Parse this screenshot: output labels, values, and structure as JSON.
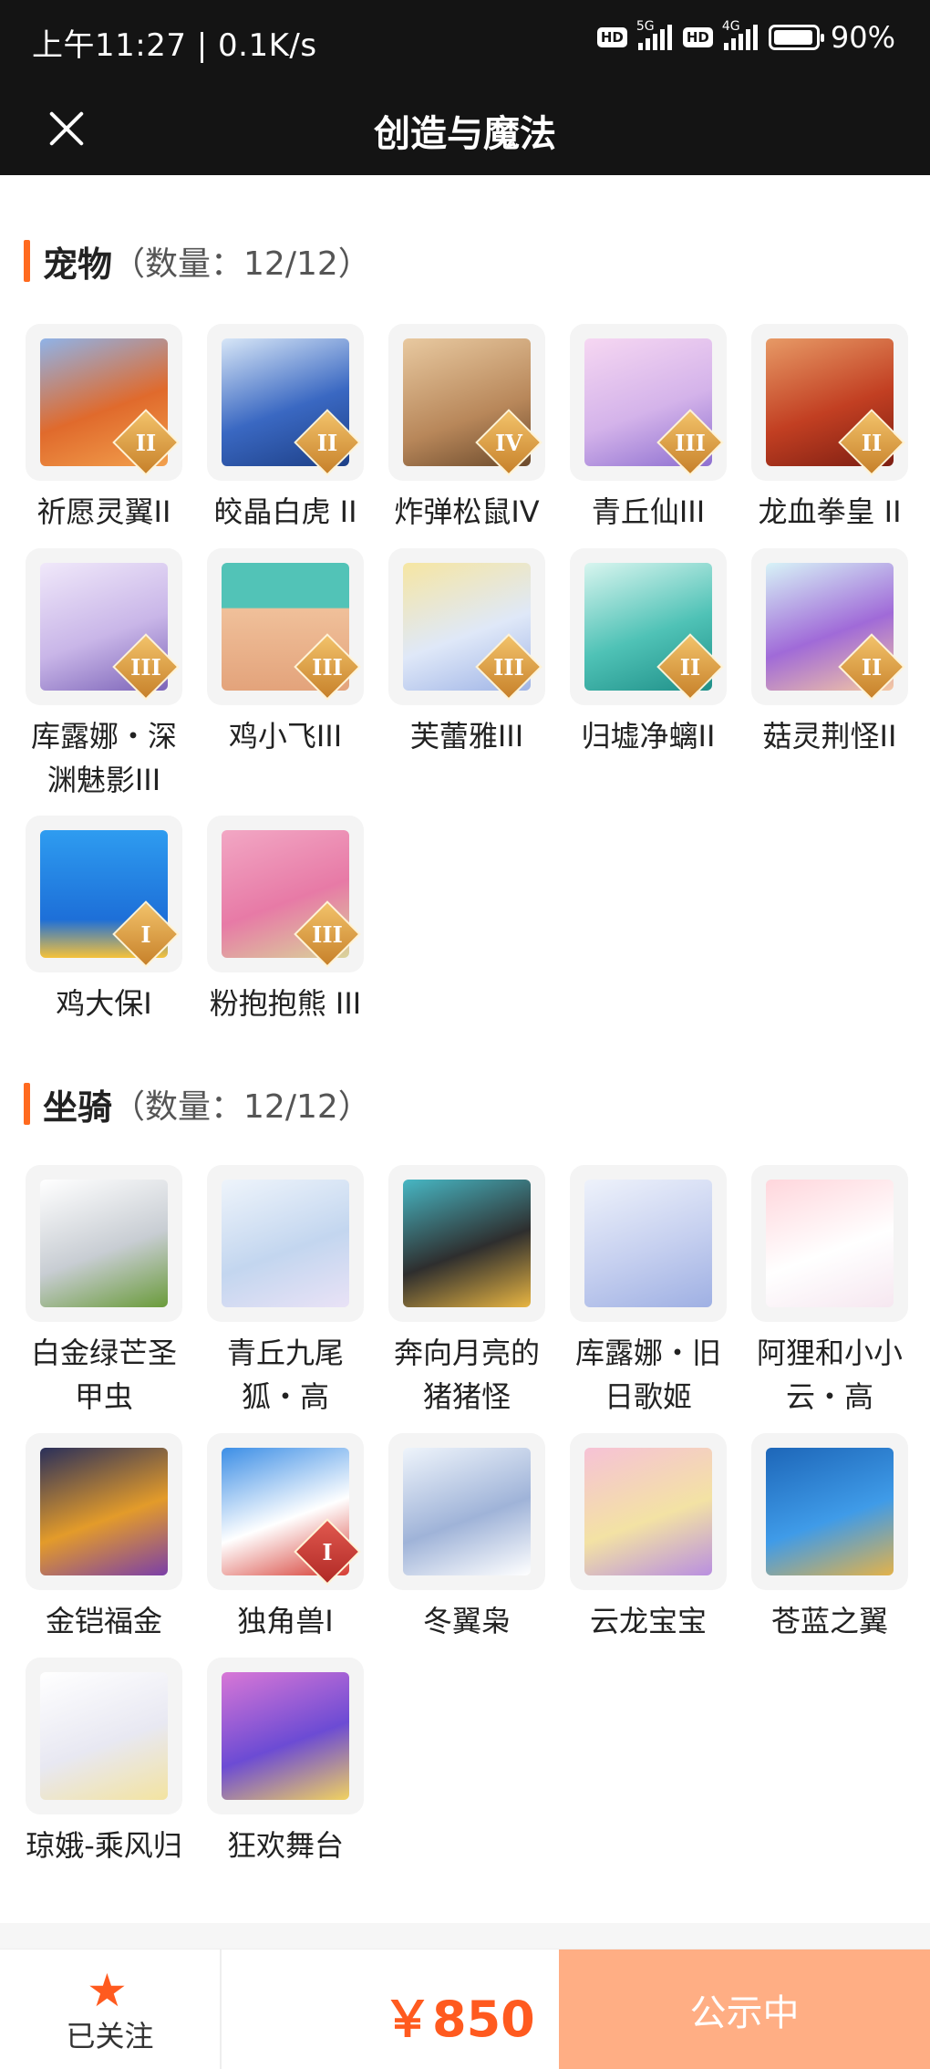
{
  "status_bar": {
    "time_speed": "上午11:27 | 0.1K/s",
    "hd1": "HD",
    "net1": "5G",
    "hd2": "HD",
    "net2": "4G",
    "battery": "90%"
  },
  "header": {
    "title": "创造与魔法"
  },
  "pets": {
    "name": "宠物",
    "count": "（数量：12/12）",
    "items": [
      {
        "label": "祈愿灵翼II",
        "badge": "II"
      },
      {
        "label": "皎晶白虎 II",
        "badge": "II"
      },
      {
        "label": "炸弹松鼠IV",
        "badge": "IV"
      },
      {
        "label": "青丘仙III",
        "badge": "III"
      },
      {
        "label": "龙血拳皇 II",
        "badge": "II"
      },
      {
        "label": "库露娜・深渊魅影III",
        "badge": "III"
      },
      {
        "label": "鸡小飞III",
        "badge": "III"
      },
      {
        "label": "芙蕾雅III",
        "badge": "III"
      },
      {
        "label": "归墟净螭II",
        "badge": "II"
      },
      {
        "label": "菇灵荆怪II",
        "badge": "II"
      },
      {
        "label": "鸡大保I",
        "badge": "I"
      },
      {
        "label": "粉抱抱熊 III",
        "badge": "III"
      }
    ]
  },
  "mounts": {
    "name": "坐骑",
    "count": "（数量：12/12）",
    "items": [
      {
        "label": "白金绿芒圣甲虫"
      },
      {
        "label": "青丘九尾狐・高"
      },
      {
        "label": "奔向月亮的猪猪怪"
      },
      {
        "label": "库露娜・旧日歌姬"
      },
      {
        "label": "阿狸和小小云・高"
      },
      {
        "label": "金铠福金"
      },
      {
        "label": "独角兽I",
        "badge": "I"
      },
      {
        "label": "冬翼枭"
      },
      {
        "label": "云龙宝宝"
      },
      {
        "label": "苍蓝之翼"
      },
      {
        "label": "琼娥-乘风归"
      },
      {
        "label": "狂欢舞台"
      }
    ]
  },
  "bottom_bar": {
    "follow_label": "已关注",
    "star_icon": "★",
    "price": "￥850",
    "status_label": "公示中"
  },
  "colors": {
    "accent": "#ff5a1f",
    "status_button": "#ffae84",
    "top_bar": "#141414"
  }
}
